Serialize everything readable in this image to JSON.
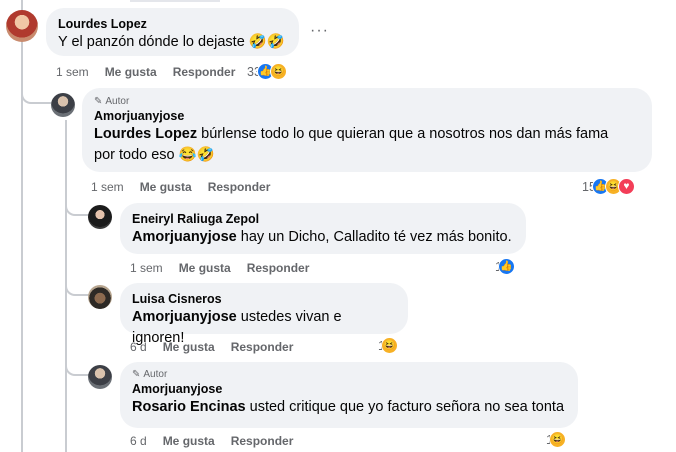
{
  "comments": [
    {
      "author": "Lourdes Lopez",
      "text": "Y el panzón dónde lo dejaste 🤣🤣",
      "time": "1 sem",
      "like": "Me gusta",
      "reply": "Responder",
      "reaction_count": "33"
    },
    {
      "badge": "Autor",
      "author": "Amorjuanyjose",
      "mention": "Lourdes Lopez",
      "text": " búrlense todo lo que quieran que a nosotros nos dan más fama",
      "text2": "por todo eso 😂🤣",
      "time": "1 sem",
      "like": "Me gusta",
      "reply": "Responder",
      "reaction_count": "15"
    },
    {
      "author": "Eneiryl Raliuga Zepol",
      "mention": "Amorjuanyjose",
      "text": " hay un Dicho, Calladito té vez más bonito.",
      "time": "1 sem",
      "like": "Me gusta",
      "reply": "Responder",
      "reaction_count": "1"
    },
    {
      "author": "Luisa Cisneros",
      "mention": "Amorjuanyjose",
      "text": " ustedes vivan e ignoren!",
      "time": "6 d",
      "like": "Me gusta",
      "reply": "Responder",
      "reaction_count": "1"
    },
    {
      "badge": "Autor",
      "author": "Amorjuanyjose",
      "mention": "Rosario Encinas",
      "text": " usted critique que yo facturo señora no sea tonta",
      "time": "6 d",
      "like": "Me gusta",
      "reply": "Responder",
      "reaction_count": "1"
    }
  ],
  "more_glyph": "···",
  "icons": {
    "like": "thumbs-up-icon",
    "haha": "laughing-face-icon",
    "love": "heart-icon",
    "author_badge": "pencil-icon"
  },
  "colors": {
    "bubble": "#f0f2f5",
    "meta": "#65676b",
    "like_blue": "#1877f2",
    "haha_yellow": "#f7b125",
    "love_red": "#f33e58"
  }
}
